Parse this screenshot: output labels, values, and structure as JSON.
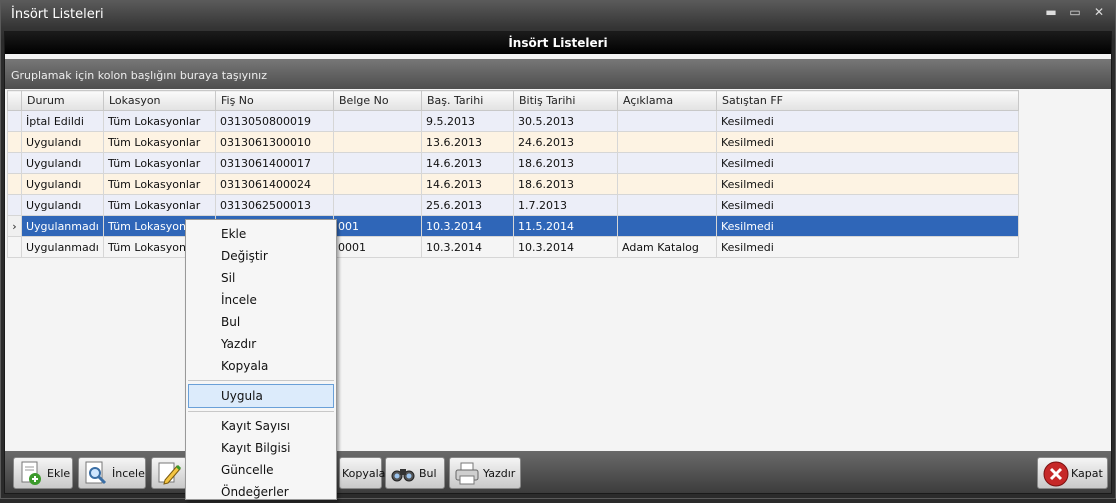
{
  "window": {
    "title": "İnsört  Listeleri",
    "btn_min": "▬",
    "btn_max": "▭",
    "btn_close": "✕"
  },
  "header": {
    "title": "İnsört Listeleri"
  },
  "group_panel": {
    "hint": "Gruplamak için kolon başlığını buraya taşıyınız"
  },
  "grid": {
    "columns": [
      "Durum",
      "Lokasyon",
      "Fiş No",
      "Belge No",
      "Baş. Tarihi",
      "Bitiş Tarihi",
      "Açıklama",
      "Satıştan FF"
    ],
    "rows": [
      [
        "İptal Edildi",
        "Tüm Lokasyonlar",
        "0313050800019",
        "",
        "9.5.2013",
        "30.5.2013",
        "",
        "Kesilmedi"
      ],
      [
        "Uygulandı",
        "Tüm Lokasyonlar",
        "0313061300010",
        "",
        "13.6.2013",
        "24.6.2013",
        "",
        "Kesilmedi"
      ],
      [
        "Uygulandı",
        "Tüm Lokasyonlar",
        "0313061400017",
        "",
        "14.6.2013",
        "18.6.2013",
        "",
        "Kesilmedi"
      ],
      [
        "Uygulandı",
        "Tüm Lokasyonlar",
        "0313061400024",
        "",
        "14.6.2013",
        "18.6.2013",
        "",
        "Kesilmedi"
      ],
      [
        "Uygulandı",
        "Tüm Lokasyonlar",
        "0313062500013",
        "",
        "25.6.2013",
        "1.7.2013",
        "",
        "Kesilmedi"
      ],
      [
        "Uygulanmadı",
        "Tüm Lokasyonlar",
        "",
        "001",
        "10.3.2014",
        "11.5.2014",
        "",
        "Kesilmedi"
      ],
      [
        "Uygulanmadı",
        "Tüm Lokasyonlar",
        "",
        "0001",
        "10.3.2014",
        "10.3.2014",
        "Adam Katalog",
        "Kesilmedi"
      ]
    ],
    "selected_indicator": "›"
  },
  "toolbar": {
    "ekle": "Ekle",
    "incele": "İncele",
    "kopyala": "Kopyala",
    "bul": "Bul",
    "yazdir": "Yazdır",
    "kapat": "Kapat"
  },
  "context_menu": {
    "items_top": [
      "Ekle",
      "Değiştir",
      "Sil",
      "İncele",
      "Bul",
      "Yazdır",
      "Kopyala"
    ],
    "highlighted": "Uygula",
    "items_bottom": [
      "Kayıt Sayısı",
      "Kayıt Bilgisi",
      "Güncelle",
      "Öndeğerler"
    ]
  },
  "colors": {
    "selection": "#2f66b8",
    "menu_highlight": "#dcebfb",
    "close_red": "#c62828"
  }
}
